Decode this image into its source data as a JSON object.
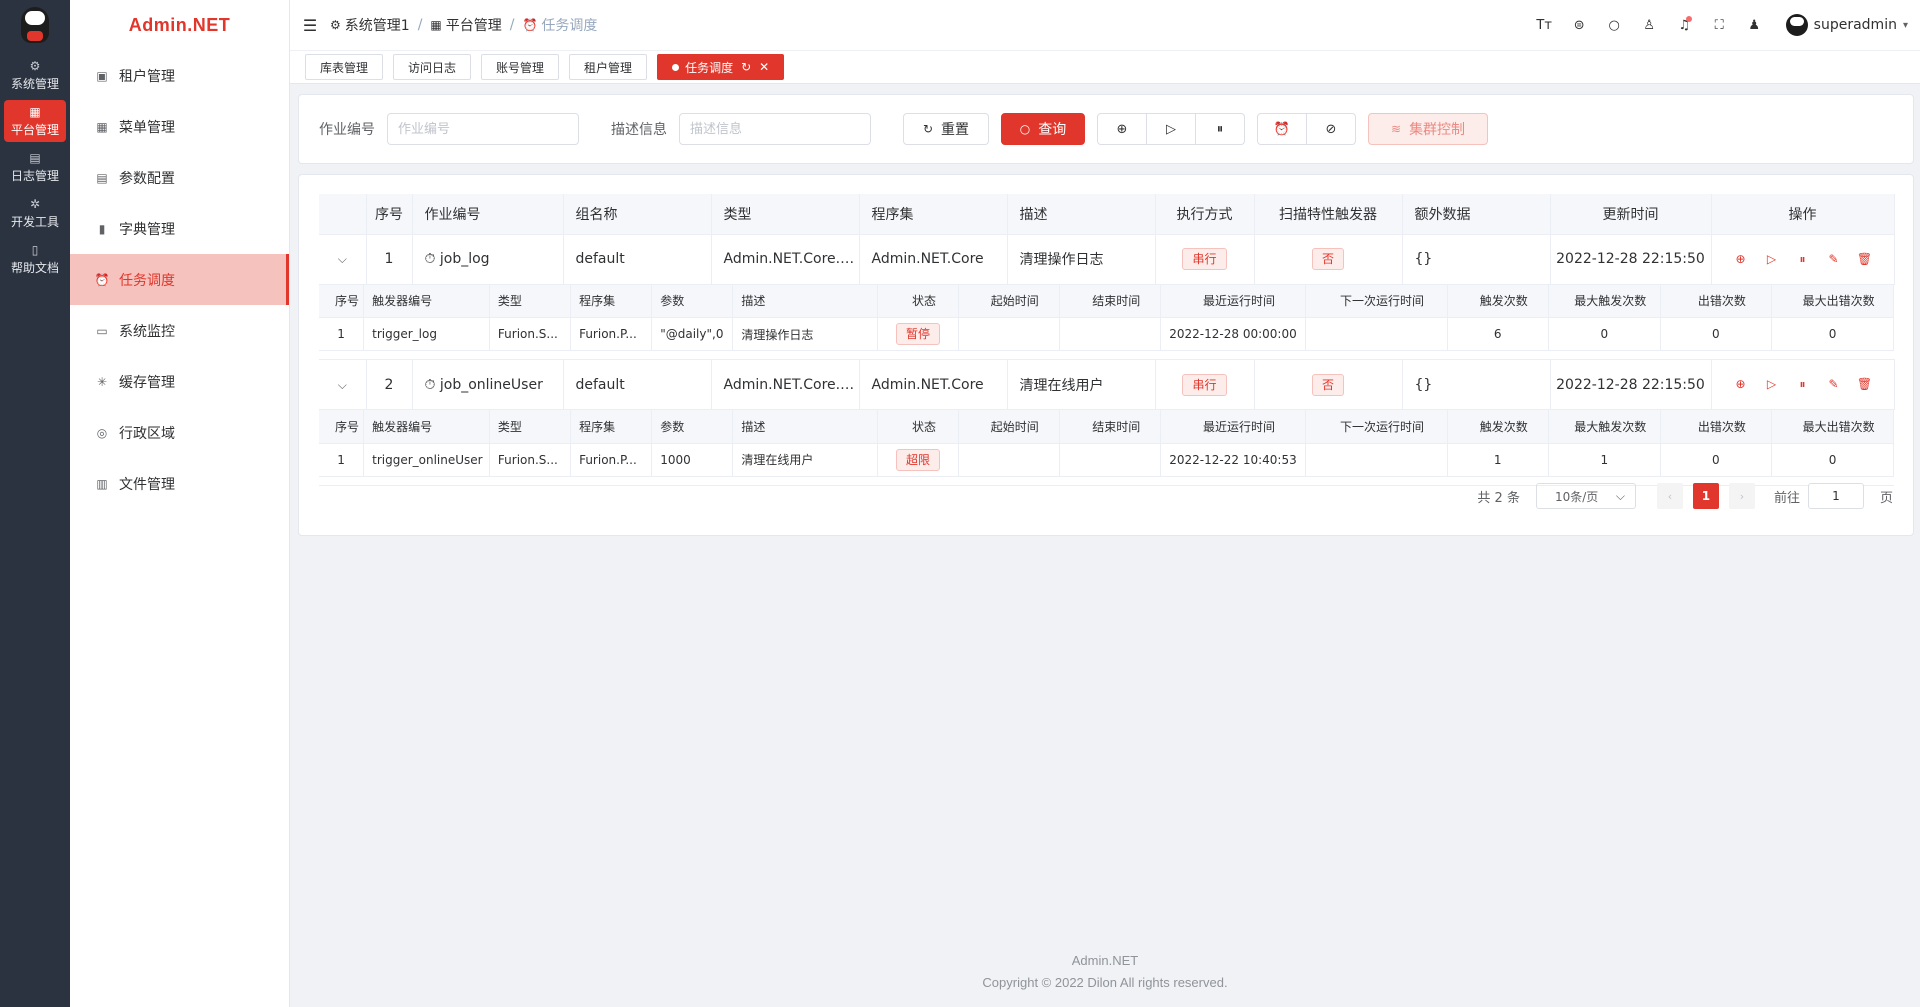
{
  "rail": {
    "items": [
      {
        "label": "系统管理",
        "icon": "⚙",
        "active": false
      },
      {
        "label": "平台管理",
        "icon": "▦",
        "active": true
      },
      {
        "label": "日志管理",
        "icon": "▤",
        "active": false
      },
      {
        "label": "开发工具",
        "icon": "✲",
        "active": false
      },
      {
        "label": "帮助文档",
        "icon": "▯",
        "active": false
      }
    ]
  },
  "submenu": {
    "brand": "Admin.NET",
    "items": [
      {
        "label": "租户管理",
        "icon": "▣"
      },
      {
        "label": "菜单管理",
        "icon": "▦"
      },
      {
        "label": "参数配置",
        "icon": "▤"
      },
      {
        "label": "字典管理",
        "icon": "▮"
      },
      {
        "label": "任务调度",
        "icon": "⏰"
      },
      {
        "label": "系统监控",
        "icon": "▭"
      },
      {
        "label": "缓存管理",
        "icon": "✳"
      },
      {
        "label": "行政区域",
        "icon": "◎"
      },
      {
        "label": "文件管理",
        "icon": "▥"
      }
    ]
  },
  "header": {
    "breadcrumb": [
      "系统管理1",
      "平台管理",
      "任务调度"
    ],
    "username": "superadmin"
  },
  "tags": [
    "库表管理",
    "访问日志",
    "账号管理",
    "租户管理",
    "任务调度"
  ],
  "search": {
    "job_label": "作业编号",
    "job_placeholder": "作业编号",
    "desc_label": "描述信息",
    "desc_placeholder": "描述信息",
    "reset": "重置",
    "query": "查询",
    "cluster": "集群控制"
  },
  "table": {
    "headers": [
      "序号",
      "作业编号",
      "组名称",
      "类型",
      "程序集",
      "描述",
      "执行方式",
      "扫描特性触发器",
      "额外数据",
      "更新时间",
      "操作"
    ],
    "sub_headers": [
      "序号",
      "触发器编号",
      "类型",
      "程序集",
      "参数",
      "描述",
      "状态",
      "起始时间",
      "结束时间",
      "最近运行时间",
      "下一次运行时间",
      "触发次数",
      "最大触发次数",
      "出错次数",
      "最大出错次数"
    ],
    "rows": [
      {
        "index": "1",
        "job_id": "job_log",
        "group": "default",
        "type": "Admin.NET.Core.Servic...",
        "assembly": "Admin.NET.Core",
        "desc": "清理操作日志",
        "mode": "串行",
        "scan": "否",
        "extra": "{}",
        "updated": "2022-12-28 22:15:50",
        "trigger": {
          "index": "1",
          "id": "trigger_log",
          "type": "Furion.S...",
          "assembly": "Furion.P...",
          "args": "\"@daily\",0",
          "desc": "清理操作日志",
          "status": "暂停",
          "start": "",
          "end": "",
          "last": "2022-12-28 00:00:00",
          "next": "",
          "count": "6",
          "max_count": "0",
          "errors": "0",
          "max_errors": "0"
        }
      },
      {
        "index": "2",
        "job_id": "job_onlineUser",
        "group": "default",
        "type": "Admin.NET.Core.Servic...",
        "assembly": "Admin.NET.Core",
        "desc": "清理在线用户",
        "mode": "串行",
        "scan": "否",
        "extra": "{}",
        "updated": "2022-12-28 22:15:50",
        "trigger": {
          "index": "1",
          "id": "trigger_onlineUser",
          "type": "Furion.S...",
          "assembly": "Furion.P...",
          "args": "1000",
          "desc": "清理在线用户",
          "status": "超限",
          "start": "",
          "end": "",
          "last": "2022-12-22 10:40:53",
          "next": "",
          "count": "1",
          "max_count": "1",
          "errors": "0",
          "max_errors": "0"
        }
      }
    ]
  },
  "pager": {
    "total": "共 2 条",
    "page_size": "10条/页",
    "current": "1",
    "goto_label": "前往",
    "goto_value": "1",
    "page_suffix": "页"
  },
  "footer": {
    "line1": "Admin.NET",
    "line2": "Copyright © 2022 Dilon All rights reserved."
  },
  "colors": {
    "accent": "#e0362b",
    "rail_bg": "#2b3340",
    "active_menu_bg": "#f6c2bd"
  }
}
